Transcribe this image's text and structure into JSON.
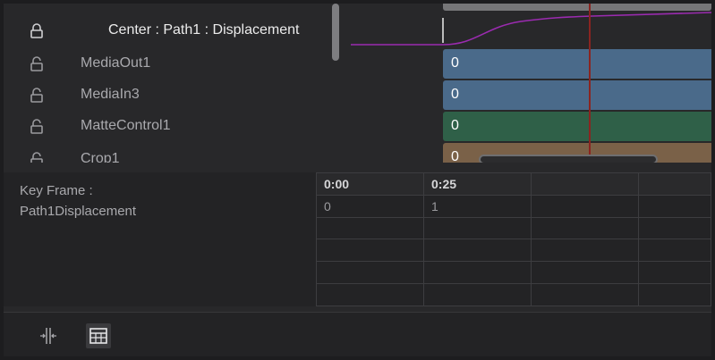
{
  "tracks": [
    {
      "label": "Center : Path1 : Displacement",
      "selected": true
    },
    {
      "label": "MediaOut1"
    },
    {
      "label": "MediaIn3"
    },
    {
      "label": "MatteControl1"
    },
    {
      "label": "Crop1"
    }
  ],
  "bars": [
    {
      "value": "0",
      "color": "#4a6a8a"
    },
    {
      "value": "0",
      "color": "#4a6a8a"
    },
    {
      "value": "0",
      "color": "#2f6048"
    },
    {
      "value": "0",
      "color": "#7a6148"
    }
  ],
  "keyframe": {
    "title": "Key Frame :",
    "param": "Path1Displacement",
    "columns": [
      "0:00",
      "0:25",
      "",
      ""
    ],
    "rows": [
      [
        "0",
        "1",
        "",
        ""
      ],
      [
        "",
        "",
        "",
        ""
      ],
      [
        "",
        "",
        "",
        ""
      ],
      [
        "",
        "",
        "",
        ""
      ],
      [
        "",
        "",
        "",
        ""
      ]
    ]
  },
  "toolbar": {
    "icons": [
      "fit-split-icon",
      "table-icon"
    ]
  },
  "colors": {
    "curve": "#9b2bb0",
    "playhead": "#8a2420",
    "background": "#28282a"
  }
}
